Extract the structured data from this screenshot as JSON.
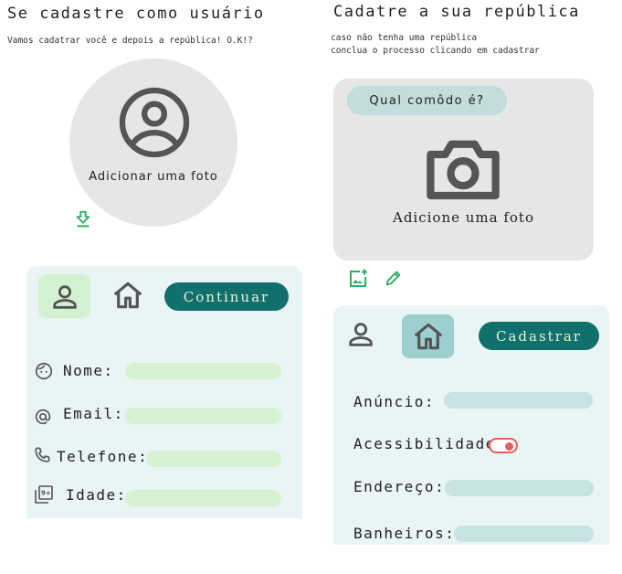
{
  "user": {
    "title": "Se cadastre como usuário",
    "subtitle": "Vamos cadatrar você e depois a república! O.K!?",
    "photo_label": "Adicionar uma foto",
    "continue_label": "Continuar",
    "fields": {
      "nome": "Nome:",
      "email": "Email:",
      "telefone": "Telefone:",
      "idade": "Idade:"
    }
  },
  "republic": {
    "title": "Cadatre a sua república",
    "subtitle_line1": "caso não tenha uma república",
    "subtitle_line2": "conclua o processo clicando em cadastrar",
    "room_question": "Qual comôdo é?",
    "photo_label": "Adicione uma foto",
    "register_label": "Cadastrar",
    "fields": {
      "anuncio": "Anúncio:",
      "acessibilidade": "Acessibilidade:",
      "endereco": "Endereço:",
      "banheiros": "Banheiros:"
    },
    "accessibility_on": true
  },
  "colors": {
    "accent": "#116f6c",
    "green_accent": "#2bb05f",
    "toggle": "#e35f5f"
  },
  "icons": {
    "user_avatar": "account-circle-icon",
    "download": "download-icon",
    "camera": "camera-icon",
    "add_photo": "add-photo-icon",
    "edit": "pencil-icon",
    "person": "person-icon",
    "home": "home-icon",
    "face": "face-icon",
    "at": "at-sign-icon",
    "phone": "phone-icon",
    "age": "filter-9-plus-icon"
  }
}
